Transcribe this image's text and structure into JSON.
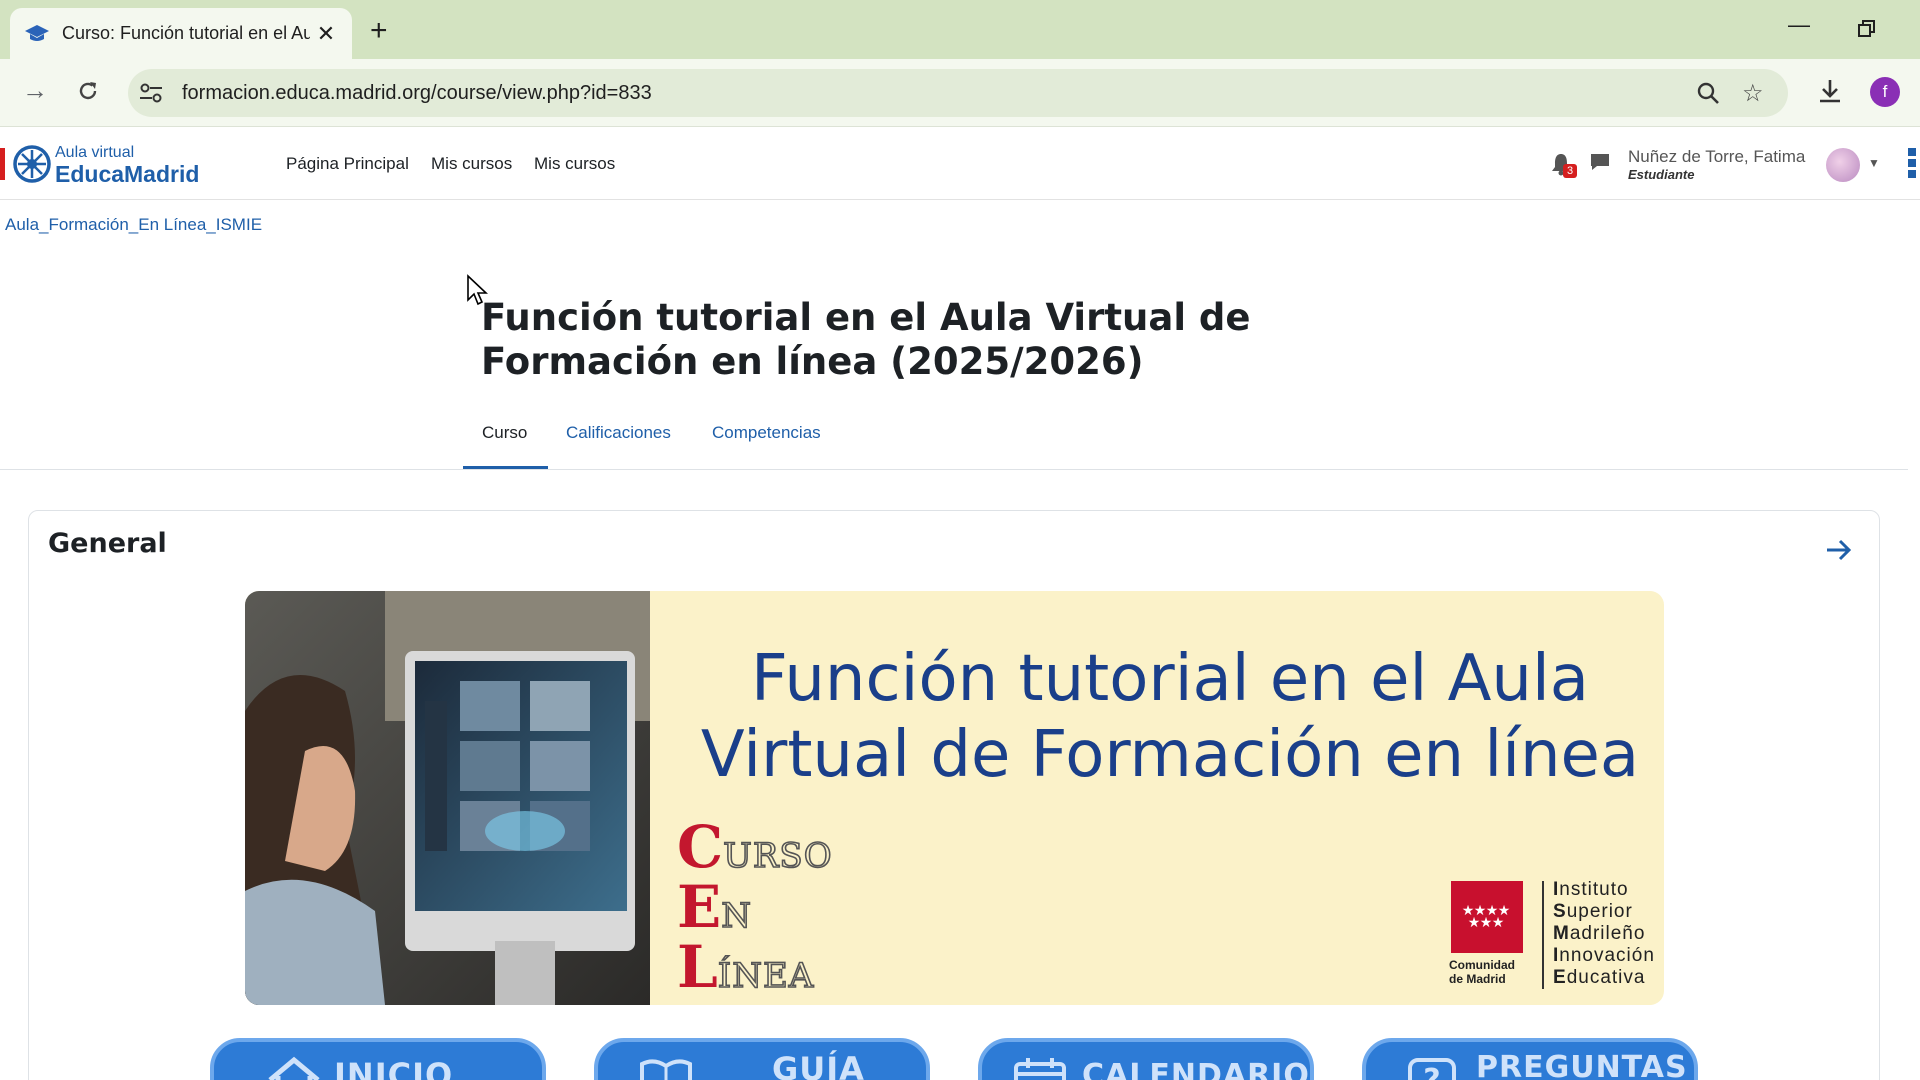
{
  "browser": {
    "tab_title": "Curso: Función tutorial en el Au",
    "url": "formacion.educa.madrid.org/course/view.php?id=833",
    "profile_initial": "f"
  },
  "site": {
    "logo_small": "Aula virtual",
    "logo_big": "EducaMadrid",
    "nav": [
      "Página Principal",
      "Mis cursos",
      "Mis cursos"
    ],
    "notifications_count": "3",
    "user_name": "Nuñez de Torre, Fatima",
    "user_role": "Estudiante"
  },
  "breadcrumb": "Aula_Formación_En Línea_ISMIE",
  "course": {
    "title": "Función tutorial en el Aula Virtual de Formación en línea (2025/2026)",
    "tabs": [
      "Curso",
      "Calificaciones",
      "Competencias"
    ],
    "active_tab": "Curso"
  },
  "section": {
    "title": "General"
  },
  "banner": {
    "title_line1": "Función tutorial en el Aula",
    "title_line2": "Virtual de Formación en línea",
    "cel": [
      {
        "initial": "C",
        "rest": "URSO"
      },
      {
        "initial": "E",
        "rest": "N"
      },
      {
        "initial": "L",
        "rest": "ÍNEA"
      }
    ],
    "cm_line1": "Comunidad",
    "cm_line2": "de Madrid",
    "ismie": [
      {
        "initial": "I",
        "rest": "nstituto"
      },
      {
        "initial": "S",
        "rest": "uperior"
      },
      {
        "initial": "M",
        "rest": "adrileño"
      },
      {
        "initial": "I",
        "rest": "nnovación"
      },
      {
        "initial": "E",
        "rest": "ducativa"
      }
    ]
  },
  "buttons": [
    {
      "label": "INICIO",
      "icon": "home-icon"
    },
    {
      "label": "GUÍA",
      "icon": "book-icon"
    },
    {
      "label": "CALENDARIO",
      "icon": "calendar-icon"
    },
    {
      "label": "PREGUNTAS",
      "icon": "question-icon"
    }
  ],
  "colors": {
    "link": "#1f5fa9",
    "banner_bg": "#fbf2c9",
    "banner_title": "#1a3f8a",
    "cel_red": "#c3172e",
    "button_blue": "#2d7bd6"
  }
}
